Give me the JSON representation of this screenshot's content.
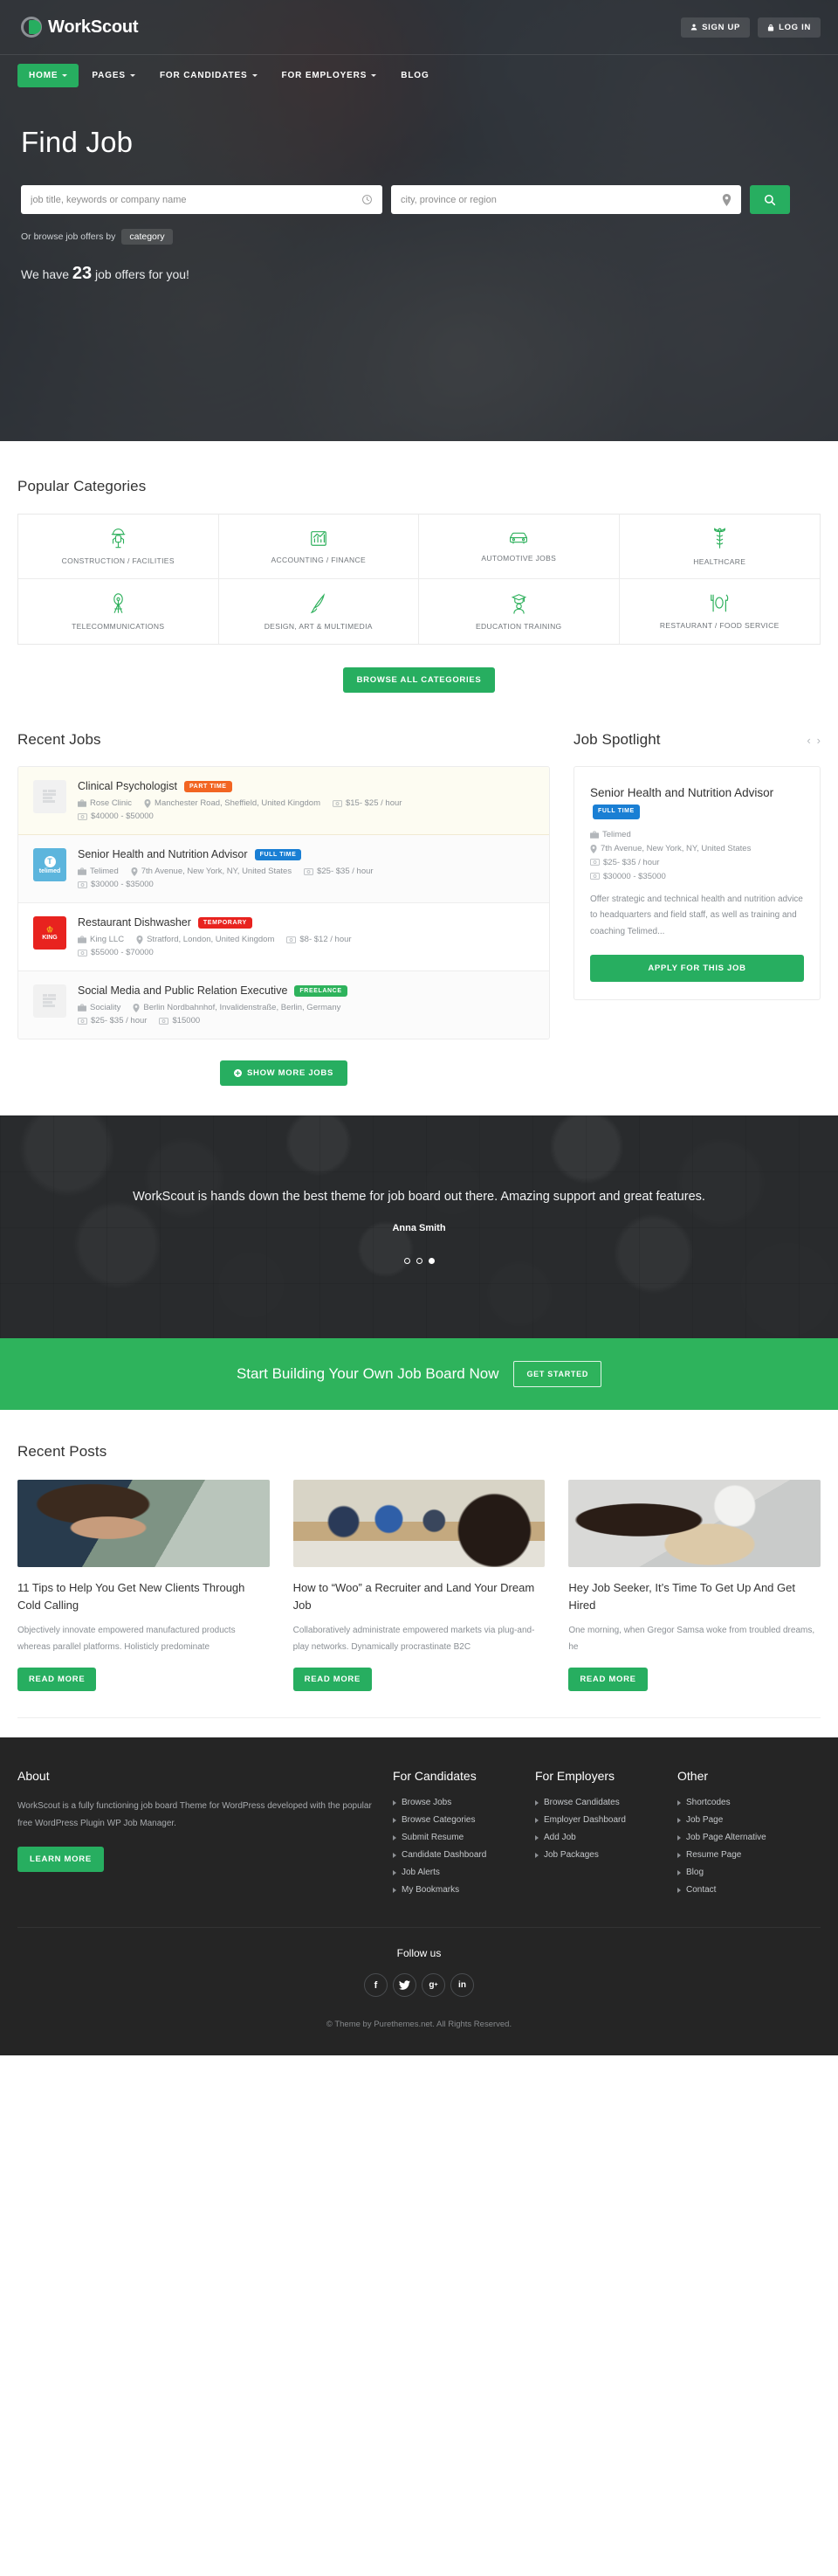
{
  "brand": {
    "name": "WorkScout",
    "accent": "#27ae60"
  },
  "header": {
    "signup_label": "SIGN UP",
    "login_label": "LOG IN",
    "nav": [
      {
        "label": "HOME",
        "caret": true,
        "active": true
      },
      {
        "label": "PAGES",
        "caret": true,
        "active": false
      },
      {
        "label": "FOR CANDIDATES",
        "caret": true,
        "active": false
      },
      {
        "label": "FOR EMPLOYERS",
        "caret": true,
        "active": false
      },
      {
        "label": "BLOG",
        "caret": false,
        "active": false
      }
    ]
  },
  "hero": {
    "title": "Find Job",
    "keyword_placeholder": "job title, keywords or company name",
    "keyword_value": "",
    "location_placeholder": "city, province or region",
    "location_value": "",
    "browse_label": "Or browse job offers by",
    "browse_pill": "category",
    "counter_pre": "We have",
    "counter_num": "23",
    "counter_post": "job offers for you!"
  },
  "categories": {
    "title": "Popular Categories",
    "items": [
      {
        "label": "CONSTRUCTION / FACILITIES",
        "icon": "hardhat-worker-icon"
      },
      {
        "label": "ACCOUNTING / FINANCE",
        "icon": "bar-chart-icon"
      },
      {
        "label": "AUTOMOTIVE JOBS",
        "icon": "car-icon"
      },
      {
        "label": "HEALTHCARE",
        "icon": "caduceus-icon"
      },
      {
        "label": "TELECOMMUNICATIONS",
        "icon": "antenna-tower-icon"
      },
      {
        "label": "DESIGN, ART & MULTIMEDIA",
        "icon": "paintbrush-icon"
      },
      {
        "label": "EDUCATION TRAINING",
        "icon": "graduate-icon"
      },
      {
        "label": "RESTAURANT / FOOD SERVICE",
        "icon": "cutlery-plate-icon"
      }
    ],
    "browse_all_label": "BROWSE ALL CATEGORIES"
  },
  "recent_jobs": {
    "title": "Recent Jobs",
    "show_more_label": "SHOW MORE JOBS",
    "items": [
      {
        "title": "Clinical Psychologist",
        "tag": "PART TIME",
        "tag_class": "parttime",
        "company": "Rose Clinic",
        "location": "Manchester Road, Sheffield, United Kingdom",
        "rate": "$15- $25 / hour",
        "salary": "$40000 - $50000",
        "logo_kind": "placeholder",
        "logo_text": "",
        "row_class": "featured"
      },
      {
        "title": "Senior Health and Nutrition Advisor",
        "tag": "FULL TIME",
        "tag_class": "fulltime",
        "company": "Telimed",
        "location": "7th Avenue, New York, NY, United States",
        "rate": "$25- $35 / hour",
        "salary": "$30000 - $35000",
        "logo_kind": "telimed",
        "logo_text": "telimed",
        "row_class": "alt"
      },
      {
        "title": "Restaurant Dishwasher",
        "tag": "TEMPORARY",
        "tag_class": "temporary",
        "company": "King LLC",
        "location": "Stratford, London, United Kingdom",
        "rate": "$8- $12 / hour",
        "salary": "$55000 - $70000",
        "logo_kind": "king",
        "logo_text": "KING",
        "row_class": ""
      },
      {
        "title": "Social Media and Public Relation Executive",
        "tag": "FREELANCE",
        "tag_class": "freelance",
        "company": "Sociality",
        "location": "Berlin Nordbahnhof, Invalidenstraße, Berlin, Germany",
        "rate": "$25- $35 / hour",
        "salary": "$15000",
        "logo_kind": "placeholder",
        "logo_text": "",
        "row_class": "alt"
      }
    ]
  },
  "spotlight": {
    "title": "Job Spotlight",
    "prev": "‹",
    "next": "›",
    "job": {
      "title": "Senior Health and Nutrition Advisor",
      "tag": "FULL TIME",
      "company": "Telimed",
      "location": "7th Avenue, New York, NY, United States",
      "rate": "$25- $35 / hour",
      "salary": "$30000 - $35000",
      "description": "Offer strategic and technical health and nutrition advice to headquarters and field staff, as well as training and coaching Telimed...",
      "apply_label": "APPLY FOR THIS JOB"
    }
  },
  "testimonial": {
    "quote": "WorkScout is hands down the best theme for job board out there. Amazing support and great features.",
    "author": "Anna Smith",
    "dots": [
      false,
      false,
      true
    ]
  },
  "cta": {
    "text": "Start Building Your Own Job Board Now",
    "button": "GET STARTED"
  },
  "posts": {
    "title": "Recent Posts",
    "read_more_label": "READ MORE",
    "items": [
      {
        "title": "11 Tips to Help You Get New Clients Through Cold Calling",
        "excerpt": "Objectively innovate empowered manufactured products whereas parallel platforms. Holisticly predominate",
        "image": "man-on-phone-photo"
      },
      {
        "title": "How to “Woo” a Recruiter and Land Your Dream Job",
        "excerpt": "Collaboratively administrate empowered markets via plug-and-play networks. Dynamically procrastinate B2C",
        "image": "interview-panel-photo"
      },
      {
        "title": "Hey Job Seeker, It’s Time To Get Up And Get Hired",
        "excerpt": "One morning, when Gregor Samsa woke from troubled dreams, he",
        "image": "sleeping-man-photo"
      }
    ]
  },
  "footer": {
    "about": {
      "title": "About",
      "text": "WorkScout is a fully functioning job board Theme for WordPress developed with the popular free WordPress Plugin WP Job Manager.",
      "button": "LEARN MORE"
    },
    "columns": [
      {
        "title": "For Candidates",
        "links": [
          "Browse Jobs",
          "Browse Categories",
          "Submit Resume",
          "Candidate Dashboard",
          "Job Alerts",
          "My Bookmarks"
        ]
      },
      {
        "title": "For Employers",
        "links": [
          "Browse Candidates",
          "Employer Dashboard",
          "Add Job",
          "Job Packages"
        ]
      },
      {
        "title": "Other",
        "links": [
          "Shortcodes",
          "Job Page",
          "Job Page Alternative",
          "Resume Page",
          "Blog",
          "Contact"
        ]
      }
    ],
    "follow_title": "Follow us",
    "socials": [
      {
        "name": "facebook-icon",
        "glyph": "f"
      },
      {
        "name": "twitter-icon",
        "glyph": "🐦"
      },
      {
        "name": "google-plus-icon",
        "glyph": "g+"
      },
      {
        "name": "linkedin-icon",
        "glyph": "in"
      }
    ],
    "copyright": "© Theme by Purethemes.net. All Rights Reserved."
  }
}
